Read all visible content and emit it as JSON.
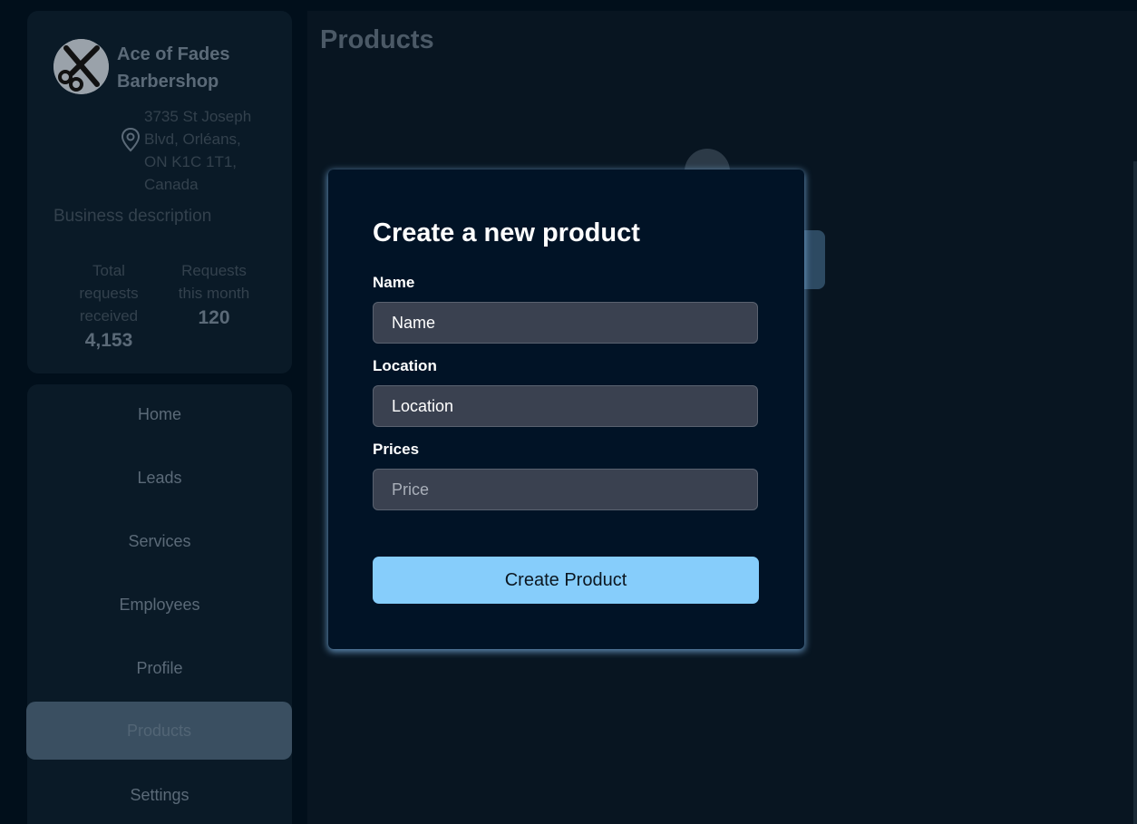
{
  "business": {
    "name": "Ace of Fades Barbershop",
    "address": "3735 St Joseph Blvd, Orléans, ON K1C 1T1, Canada",
    "description_placeholder": "Business description",
    "stats": [
      {
        "label": "Total requests received",
        "value": "4,153"
      },
      {
        "label": "Requests this month",
        "value": "120"
      }
    ]
  },
  "nav": {
    "items": [
      {
        "label": "Home",
        "active": false
      },
      {
        "label": "Leads",
        "active": false
      },
      {
        "label": "Services",
        "active": false
      },
      {
        "label": "Employees",
        "active": false
      },
      {
        "label": "Profile",
        "active": false
      },
      {
        "label": "Products",
        "active": true
      },
      {
        "label": "Settings",
        "active": false
      }
    ]
  },
  "main": {
    "title": "Products"
  },
  "modal": {
    "title": "Create a new product",
    "fields": {
      "name": {
        "label": "Name",
        "value": "Name",
        "placeholder": "Name"
      },
      "location": {
        "label": "Location",
        "value": "Location",
        "placeholder": "Location"
      },
      "price": {
        "label": "Prices",
        "value": "",
        "placeholder": "Price"
      }
    },
    "submit_label": "Create Product"
  },
  "colors": {
    "accent": "#86cdfb",
    "modal_bg": "#011326",
    "input_bg": "#3a4150",
    "nav_active_bg": "#3a4f61"
  }
}
